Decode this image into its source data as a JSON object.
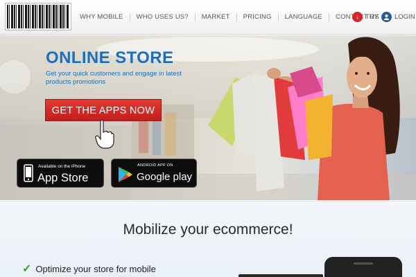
{
  "header": {
    "nav": [
      "WHY MOBILE",
      "WHO USES US?",
      "MARKET",
      "PRICING",
      "LANGUAGE",
      "CONTACT US"
    ],
    "try_label": "TRY",
    "login_label": "LOGIN"
  },
  "hero": {
    "title": "ONLINE STORE",
    "subtitle": "Get your quick customers and engage in latest products promotions",
    "cta_label": "GET THE APPS NOW",
    "appstore_small": "Available on the iPhone",
    "appstore_big": "App Store",
    "gplay_small": "ANDROID APP ON",
    "gplay_big": "Google play"
  },
  "lower": {
    "tagline": "Mobilize your ecommerce!",
    "feature_1": "Optimize your store for mobile"
  },
  "colors": {
    "accent_blue": "#1c6fb8",
    "cta_red": "#d8262b",
    "check_green": "#3aa02c"
  }
}
